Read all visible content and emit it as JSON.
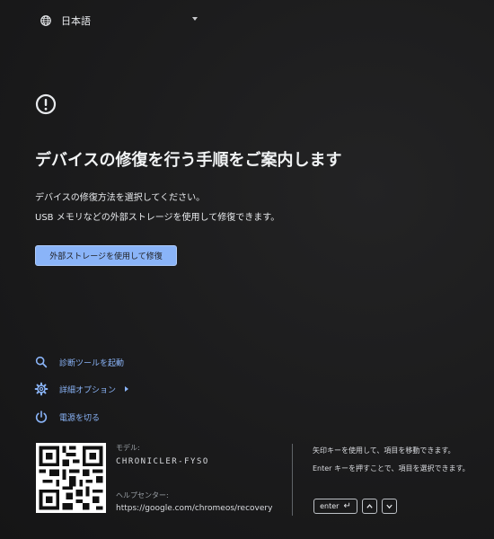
{
  "language": {
    "selected": "日本語",
    "icon": "globe-icon"
  },
  "header": {
    "icon": "exclamation-circle-icon",
    "title": "デバイスの修復を行う手順をご案内します"
  },
  "description": {
    "line1": "デバイスの修復方法を選択してください。",
    "line2": "USB メモリなどの外部ストレージを使用して修復できます。"
  },
  "primary_action": {
    "label": "外部ストレージを使用して修復"
  },
  "options": {
    "diagnostics": "診断ツールを起動",
    "advanced": "詳細オプション",
    "power_off": "電源を切る"
  },
  "footer": {
    "model_label": "モデル:",
    "model_value": "CHRONICLER-FYSO",
    "help_label": "ヘルプセンター:",
    "help_url": "https://google.com/chromeos/recovery",
    "hint_navigate": "矢印キーを使用して、項目を移動できます。",
    "hint_select": "Enter キーを押すことで、項目を選択できます。",
    "enter_key": "enter",
    "enter_glyph": "↵"
  },
  "colors": {
    "background": "#1b1b1c",
    "accent": "#8ab4f8",
    "text": "#e8eaed",
    "muted": "#9aa0a6"
  }
}
